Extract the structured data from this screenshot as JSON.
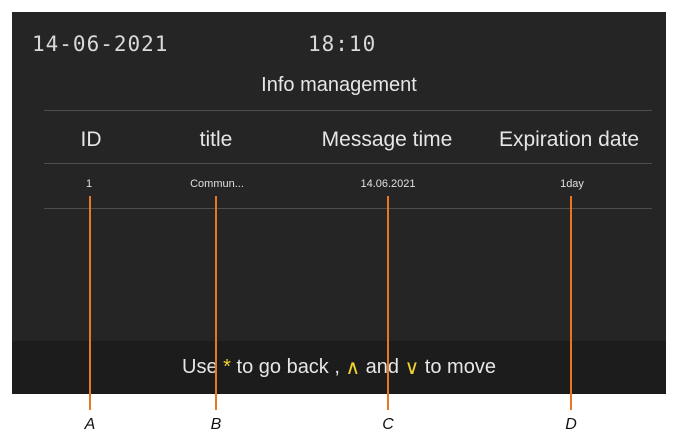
{
  "status_bar": {
    "date": "14-06-2021",
    "time": "18:10"
  },
  "screen": {
    "title": "Info management"
  },
  "table": {
    "columns": [
      "ID",
      "title",
      "Message time",
      "Expiration date"
    ],
    "rows": [
      [
        "1",
        "Commun...",
        "14.06.2021",
        "1day"
      ]
    ]
  },
  "footer": {
    "prefix": "Use ",
    "back_key": "*",
    "back_text": " to go back , ",
    "up_key": "∧",
    "and_text": " and ",
    "down_key": "∨",
    "move_text": " to move"
  },
  "callouts": [
    "A",
    "B",
    "C",
    "D"
  ],
  "colors": {
    "screen_bg": "#252525",
    "key_highlight": "#f2d22e",
    "callout_line": "#e87722"
  }
}
